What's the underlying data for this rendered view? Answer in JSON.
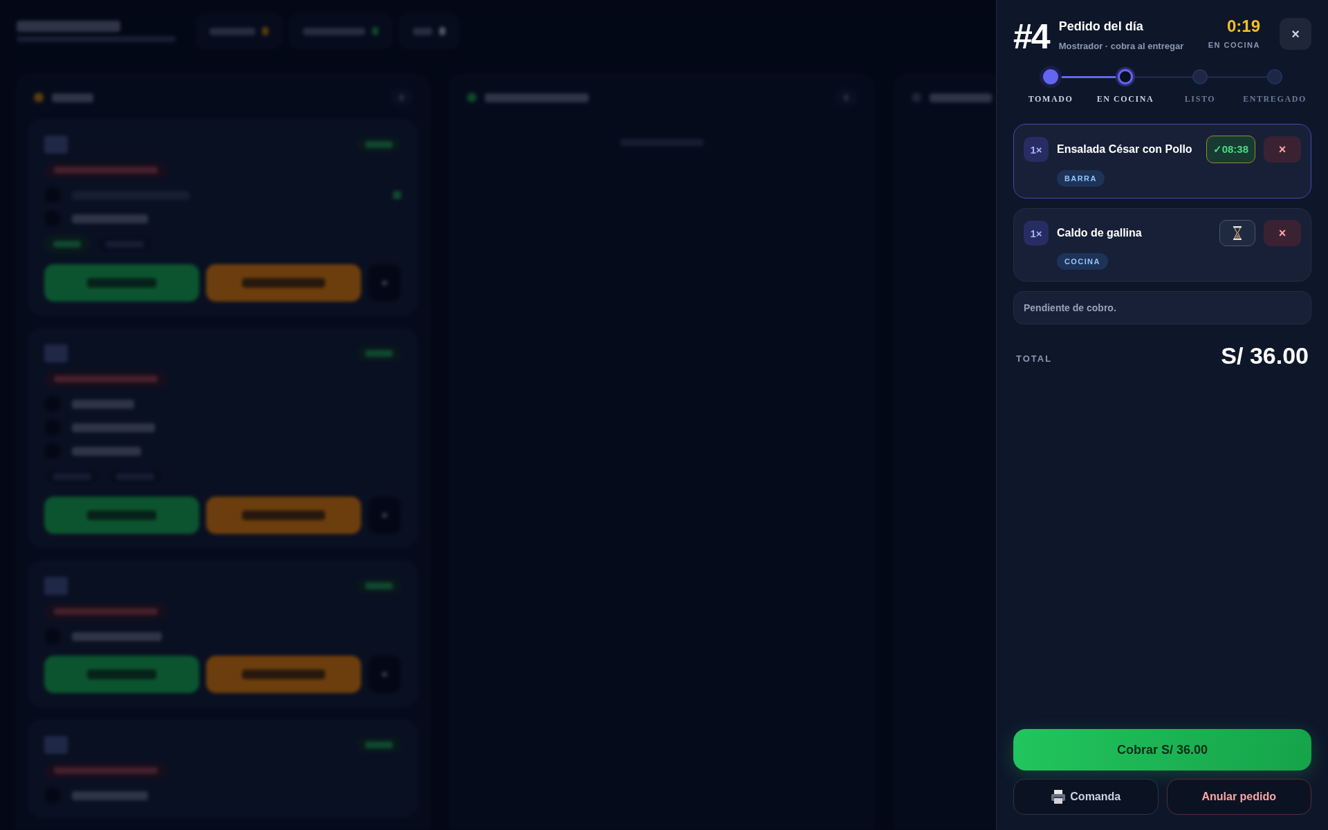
{
  "panel": {
    "number": "#4",
    "title": "Pedido del día",
    "subtitle": "Mostrador · cobra al entregar",
    "timer": "0:19",
    "status": "EN COCINA",
    "close_button": "×",
    "steps": [
      {
        "label": "TOMADO",
        "done": true,
        "selected": false
      },
      {
        "label": "EN COCINA",
        "done": false,
        "selected": true
      },
      {
        "label": "LISTO",
        "done": false,
        "selected": false
      },
      {
        "label": "ENTREGADO",
        "done": false,
        "selected": false
      }
    ],
    "items": [
      {
        "qty": "1×",
        "name": "Ensalada César con Pollo",
        "station": "BARRA",
        "kind": "done",
        "time": "✓08:38",
        "selected": true,
        "remove_button": "×"
      },
      {
        "qty": "1×",
        "name": "Caldo de gallina",
        "station": "COCINA",
        "kind": "pending",
        "selected": false,
        "remove_button": "×"
      }
    ],
    "note": "Pendiente de cobro.",
    "total_label": "TOTAL",
    "total": "S/ 36.00",
    "charge_button": "Cobrar S/ 36.00",
    "print_button": "Comanda",
    "void_button": "Anular pedido"
  }
}
